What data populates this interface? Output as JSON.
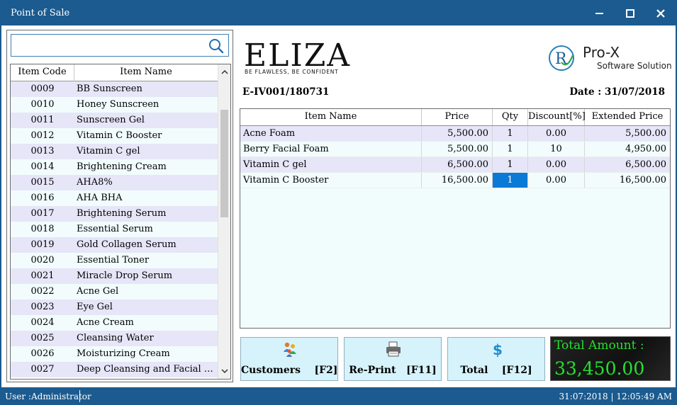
{
  "window": {
    "title": "Point of Sale"
  },
  "search": {
    "value": "",
    "placeholder": ""
  },
  "item_list": {
    "headers": {
      "code": "Item Code",
      "name": "Item Name"
    },
    "rows": [
      {
        "code": "0009",
        "name": "BB Sunscreen"
      },
      {
        "code": "0010",
        "name": "Honey Sunscreen"
      },
      {
        "code": "0011",
        "name": "Sunscreen Gel"
      },
      {
        "code": "0012",
        "name": "Vitamin C Booster"
      },
      {
        "code": "0013",
        "name": "Vitamin C gel"
      },
      {
        "code": "0014",
        "name": "Brightening Cream"
      },
      {
        "code": "0015",
        "name": "AHA8%"
      },
      {
        "code": "0016",
        "name": "AHA BHA"
      },
      {
        "code": "0017",
        "name": "Brightening Serum"
      },
      {
        "code": "0018",
        "name": "Essential Serum"
      },
      {
        "code": "0019",
        "name": "Gold Collagen Serum"
      },
      {
        "code": "0020",
        "name": "Essential Toner"
      },
      {
        "code": "0021",
        "name": "Miracle Drop Serum"
      },
      {
        "code": "0022",
        "name": "Acne Gel"
      },
      {
        "code": "0023",
        "name": "Eye Gel"
      },
      {
        "code": "0024",
        "name": "Acne Cream"
      },
      {
        "code": "0025",
        "name": "Cleansing Water"
      },
      {
        "code": "0026",
        "name": "Moisturizing Cream"
      },
      {
        "code": "0027",
        "name": "Deep Cleansing and Facial Mas..."
      }
    ]
  },
  "brand": {
    "eliza": {
      "word": "ELIZA",
      "tagline": "BE FLAWLESS, BE CONFIDENT"
    },
    "prox": {
      "name": "Pro-X",
      "subtitle": "Software Solution"
    }
  },
  "invoice": {
    "number": "E-IV001/180731",
    "date": "Date : 31/07/2018"
  },
  "sale_table": {
    "headers": {
      "item": "Item Name",
      "price": "Price",
      "qty": "Qty",
      "discount": "Discount[%]",
      "extended": "Extended Price"
    },
    "rows": [
      {
        "item": "Acne Foam",
        "price": "5,500.00",
        "qty": "1",
        "discount": "0.00",
        "extended": "5,500.00"
      },
      {
        "item": "Berry Facial Foam",
        "price": "5,500.00",
        "qty": "1",
        "discount": "10",
        "extended": "4,950.00"
      },
      {
        "item": "Vitamin C gel",
        "price": "6,500.00",
        "qty": "1",
        "discount": "0.00",
        "extended": "6,500.00"
      },
      {
        "item": "Vitamin C Booster",
        "price": "16,500.00",
        "qty": "1",
        "discount": "0.00",
        "extended": "16,500.00"
      }
    ]
  },
  "buttons": {
    "customers": {
      "label": "Customers    [F2]",
      "icon": "customers-icon"
    },
    "reprint": {
      "label": "Re-Print   [F11]",
      "icon": "printer-icon"
    },
    "total": {
      "label": "Total    [F12]",
      "icon": "dollar-icon"
    }
  },
  "total": {
    "label": "Total Amount :",
    "amount": "33,450.00"
  },
  "status": {
    "user": "User :Administrator",
    "datetime": "31:07:2018 | 12:05:49 AM"
  },
  "colors": {
    "titlebar": "#1b5b8f",
    "row_alt": "#e6e6f8",
    "row_base": "#f2fcfd",
    "selected_cell": "#0b79d6",
    "total_text": "#26e030",
    "button_bg": "#d6f2fb"
  }
}
